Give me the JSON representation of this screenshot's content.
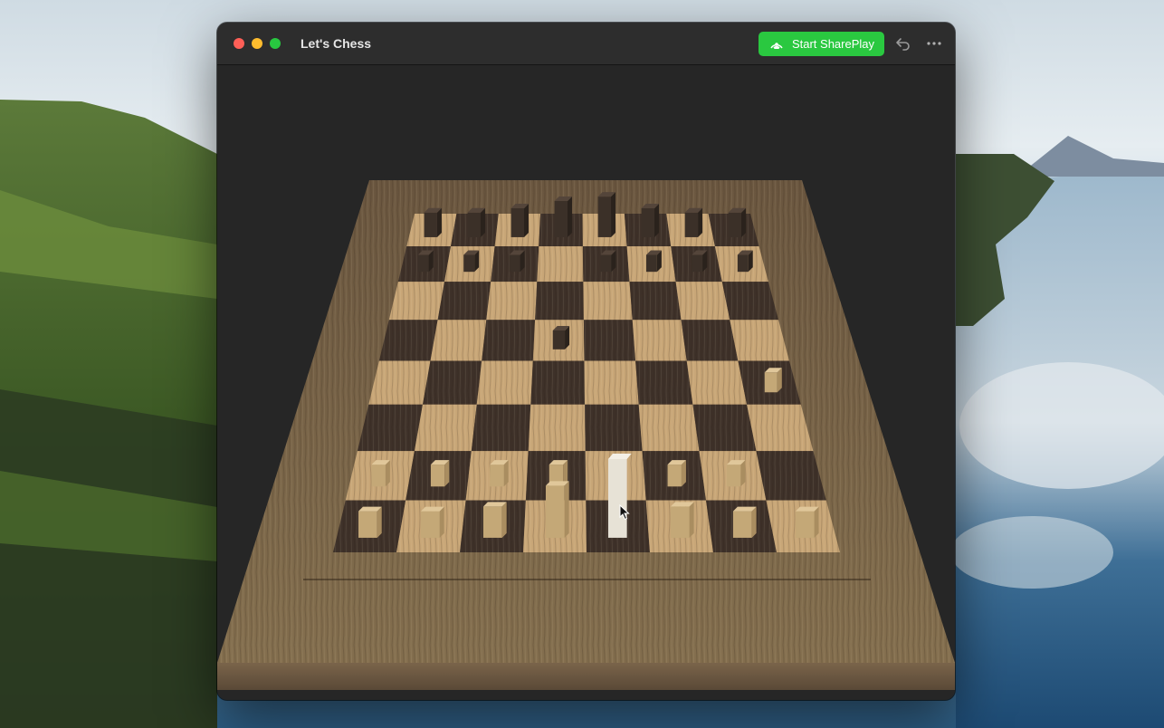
{
  "window": {
    "title": "Let's Chess",
    "traffic_lights": {
      "close": "#fe5f57",
      "minimize": "#febc2e",
      "zoom": "#28c840"
    }
  },
  "toolbar": {
    "shareplay_label": "Start SharePlay",
    "shareplay_icon": "shareplay-icon",
    "shareplay_color": "#2ac840",
    "undo_icon": "undo-icon",
    "more_icon": "more-icon"
  },
  "board": {
    "light_square": "#c8a677",
    "dark_square": "#3e3129",
    "frame_color": "#7b6349",
    "black_pieces": [
      {
        "file": 0,
        "rank": 7,
        "type": "rook"
      },
      {
        "file": 1,
        "rank": 7,
        "type": "knight"
      },
      {
        "file": 2,
        "rank": 7,
        "type": "bishop"
      },
      {
        "file": 3,
        "rank": 7,
        "type": "queen"
      },
      {
        "file": 4,
        "rank": 7,
        "type": "king"
      },
      {
        "file": 5,
        "rank": 7,
        "type": "bishop"
      },
      {
        "file": 6,
        "rank": 7,
        "type": "knight"
      },
      {
        "file": 7,
        "rank": 7,
        "type": "rook"
      },
      {
        "file": 0,
        "rank": 6,
        "type": "pawn"
      },
      {
        "file": 1,
        "rank": 6,
        "type": "pawn"
      },
      {
        "file": 2,
        "rank": 6,
        "type": "pawn"
      },
      {
        "file": 4,
        "rank": 6,
        "type": "pawn"
      },
      {
        "file": 5,
        "rank": 6,
        "type": "pawn"
      },
      {
        "file": 6,
        "rank": 6,
        "type": "pawn"
      },
      {
        "file": 7,
        "rank": 6,
        "type": "pawn"
      },
      {
        "file": 3,
        "rank": 4,
        "type": "pawn"
      }
    ],
    "white_pieces": [
      {
        "file": 0,
        "rank": 0,
        "type": "rook"
      },
      {
        "file": 1,
        "rank": 0,
        "type": "knight"
      },
      {
        "file": 2,
        "rank": 0,
        "type": "bishop"
      },
      {
        "file": 3,
        "rank": 0,
        "type": "queen"
      },
      {
        "file": 4,
        "rank": 0,
        "type": "king",
        "selected": true
      },
      {
        "file": 5,
        "rank": 0,
        "type": "bishop"
      },
      {
        "file": 6,
        "rank": 0,
        "type": "knight"
      },
      {
        "file": 7,
        "rank": 0,
        "type": "rook"
      },
      {
        "file": 0,
        "rank": 1,
        "type": "pawn"
      },
      {
        "file": 1,
        "rank": 1,
        "type": "pawn"
      },
      {
        "file": 2,
        "rank": 1,
        "type": "pawn"
      },
      {
        "file": 3,
        "rank": 1,
        "type": "pawn"
      },
      {
        "file": 5,
        "rank": 1,
        "type": "pawn"
      },
      {
        "file": 6,
        "rank": 1,
        "type": "pawn"
      },
      {
        "file": 7,
        "rank": 3,
        "type": "pawn"
      }
    ]
  }
}
